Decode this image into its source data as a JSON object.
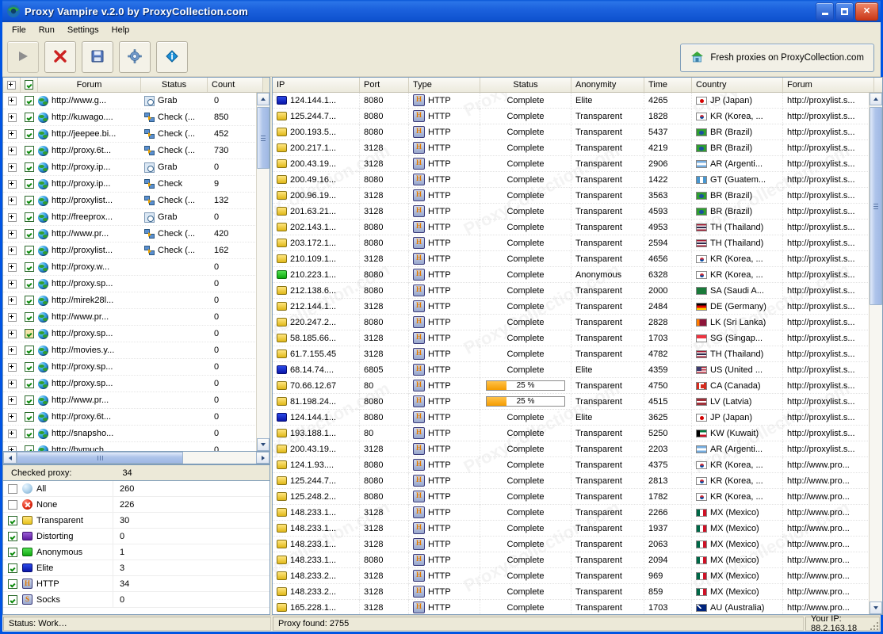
{
  "window": {
    "title": "Proxy Vampire v.2.0 by ProxyCollection.com",
    "minimize_label": "Minimize",
    "maximize_label": "Maximize",
    "close_label": "Close"
  },
  "menu": [
    "File",
    "Run",
    "Settings",
    "Help"
  ],
  "toolbar": {
    "buttons": [
      {
        "name": "start",
        "icon": "play-icon",
        "disabled": true
      },
      {
        "name": "stop",
        "icon": "red-x-icon",
        "disabled": false
      },
      {
        "name": "save",
        "icon": "floppy-disk-icon",
        "disabled": false
      },
      {
        "name": "settings",
        "icon": "gear-icon",
        "disabled": false
      },
      {
        "name": "about",
        "icon": "info-diamond-icon",
        "disabled": false
      }
    ],
    "fresh_label": "Fresh proxies on ProxyCollection.com",
    "fresh_icon": "house-icon"
  },
  "left_panel": {
    "columns": [
      "Forum",
      "Status",
      "Count"
    ],
    "header_expand_icon": "expand-all-icon",
    "header_check_icon": "check-all-icon",
    "rows": [
      {
        "name": "http://www.g...",
        "status": "Grab",
        "status_icon": "grab-icon",
        "count": "0",
        "checked": true
      },
      {
        "name": "http://kuwago....",
        "status": "Check (...",
        "status_icon": "check-icon",
        "count": "850",
        "checked": true
      },
      {
        "name": "http://jeepee.bi...",
        "status": "Check (...",
        "status_icon": "check-icon",
        "count": "452",
        "checked": true
      },
      {
        "name": "http://proxy.6t...",
        "status": "Check (...",
        "status_icon": "check-icon",
        "count": "730",
        "checked": true
      },
      {
        "name": "http://proxy.ip...",
        "status": "Grab",
        "status_icon": "grab-icon",
        "count": "0",
        "checked": true
      },
      {
        "name": "http://proxy.ip...",
        "status": "Check",
        "status_icon": "check-icon",
        "count": "9",
        "checked": true
      },
      {
        "name": "http://proxylist...",
        "status": "Check (...",
        "status_icon": "check-icon",
        "count": "132",
        "checked": true
      },
      {
        "name": "http://freeprox...",
        "status": "Grab",
        "status_icon": "grab-icon",
        "count": "0",
        "checked": true
      },
      {
        "name": "http://www.pr...",
        "status": "Check (...",
        "status_icon": "check-icon",
        "count": "420",
        "checked": true
      },
      {
        "name": "http://proxylist...",
        "status": "Check (...",
        "status_icon": "check-icon",
        "count": "162",
        "checked": true
      },
      {
        "name": "http://proxy.w...",
        "status": "",
        "status_icon": "",
        "count": "0",
        "checked": true
      },
      {
        "name": "http://proxy.sp...",
        "status": "",
        "status_icon": "",
        "count": "0",
        "checked": true
      },
      {
        "name": "http://mirek28l...",
        "status": "",
        "status_icon": "",
        "count": "0",
        "checked": true
      },
      {
        "name": "http://www.pr...",
        "status": "",
        "status_icon": "",
        "count": "0",
        "checked": true
      },
      {
        "name": "http://proxy.sp...",
        "status": "",
        "status_icon": "",
        "count": "0",
        "checked": true,
        "highlight": true
      },
      {
        "name": "http://movies.y...",
        "status": "",
        "status_icon": "",
        "count": "0",
        "checked": true
      },
      {
        "name": "http://proxy.sp...",
        "status": "",
        "status_icon": "",
        "count": "0",
        "checked": true
      },
      {
        "name": "http://proxy.sp...",
        "status": "",
        "status_icon": "",
        "count": "0",
        "checked": true
      },
      {
        "name": "http://www.pr...",
        "status": "",
        "status_icon": "",
        "count": "0",
        "checked": true
      },
      {
        "name": "http://proxy.6t...",
        "status": "",
        "status_icon": "",
        "count": "0",
        "checked": true
      },
      {
        "name": "http://snapsho...",
        "status": "",
        "status_icon": "",
        "count": "0",
        "checked": true
      },
      {
        "name": "http://bymuch...",
        "status": "",
        "status_icon": "",
        "count": "0",
        "checked": true
      }
    ]
  },
  "checked_proxy": {
    "label": "Checked proxy:",
    "value": "34",
    "rows": [
      {
        "label": "All",
        "count": "260",
        "checked": false,
        "swatch": "all"
      },
      {
        "label": "None",
        "count": "226",
        "checked": false,
        "swatch": "none"
      },
      {
        "label": "Transparent",
        "count": "30",
        "checked": true,
        "swatch": "transparent"
      },
      {
        "label": "Distorting",
        "count": "0",
        "checked": true,
        "swatch": "distorting"
      },
      {
        "label": "Anonymous",
        "count": "1",
        "checked": true,
        "swatch": "anonymous"
      },
      {
        "label": "Elite",
        "count": "3",
        "checked": true,
        "swatch": "elite"
      },
      {
        "label": "HTTP",
        "count": "34",
        "checked": true,
        "swatch": "http",
        "glyph": "H"
      },
      {
        "label": "Socks",
        "count": "0",
        "checked": true,
        "swatch": "socks",
        "glyph": "S"
      }
    ]
  },
  "table": {
    "columns": [
      "IP",
      "Port",
      "Type",
      "Status",
      "Anonymity",
      "Time",
      "Country",
      "Forum"
    ],
    "rows": [
      {
        "ip": "124.144.1...",
        "port": "8080",
        "type": "HTTP",
        "status": "Complete",
        "anonymity": "Elite",
        "time": "4265",
        "country": "JP (Japan)",
        "cc": "JP",
        "forum": "http://proxylist.s..."
      },
      {
        "ip": "125.244.7...",
        "port": "8080",
        "type": "HTTP",
        "status": "Complete",
        "anonymity": "Transparent",
        "time": "1828",
        "country": "KR (Korea, ...",
        "cc": "KR",
        "forum": "http://proxylist.s..."
      },
      {
        "ip": "200.193.5...",
        "port": "8080",
        "type": "HTTP",
        "status": "Complete",
        "anonymity": "Transparent",
        "time": "5437",
        "country": "BR (Brazil)",
        "cc": "BR",
        "forum": "http://proxylist.s..."
      },
      {
        "ip": "200.217.1...",
        "port": "3128",
        "type": "HTTP",
        "status": "Complete",
        "anonymity": "Transparent",
        "time": "4219",
        "country": "BR (Brazil)",
        "cc": "BR",
        "forum": "http://proxylist.s..."
      },
      {
        "ip": "200.43.19...",
        "port": "3128",
        "type": "HTTP",
        "status": "Complete",
        "anonymity": "Transparent",
        "time": "2906",
        "country": "AR (Argenti...",
        "cc": "AR",
        "forum": "http://proxylist.s..."
      },
      {
        "ip": "200.49.16...",
        "port": "8080",
        "type": "HTTP",
        "status": "Complete",
        "anonymity": "Transparent",
        "time": "1422",
        "country": "GT (Guatem...",
        "cc": "GT",
        "forum": "http://proxylist.s..."
      },
      {
        "ip": "200.96.19...",
        "port": "3128",
        "type": "HTTP",
        "status": "Complete",
        "anonymity": "Transparent",
        "time": "3563",
        "country": "BR (Brazil)",
        "cc": "BR",
        "forum": "http://proxylist.s..."
      },
      {
        "ip": "201.63.21...",
        "port": "3128",
        "type": "HTTP",
        "status": "Complete",
        "anonymity": "Transparent",
        "time": "4593",
        "country": "BR (Brazil)",
        "cc": "BR",
        "forum": "http://proxylist.s..."
      },
      {
        "ip": "202.143.1...",
        "port": "8080",
        "type": "HTTP",
        "status": "Complete",
        "anonymity": "Transparent",
        "time": "4953",
        "country": "TH (Thailand)",
        "cc": "TH",
        "forum": "http://proxylist.s..."
      },
      {
        "ip": "203.172.1...",
        "port": "8080",
        "type": "HTTP",
        "status": "Complete",
        "anonymity": "Transparent",
        "time": "2594",
        "country": "TH (Thailand)",
        "cc": "TH",
        "forum": "http://proxylist.s..."
      },
      {
        "ip": "210.109.1...",
        "port": "3128",
        "type": "HTTP",
        "status": "Complete",
        "anonymity": "Transparent",
        "time": "4656",
        "country": "KR (Korea, ...",
        "cc": "KR",
        "forum": "http://proxylist.s..."
      },
      {
        "ip": "210.223.1...",
        "port": "8080",
        "type": "HTTP",
        "status": "Complete",
        "anonymity": "Anonymous",
        "time": "6328",
        "country": "KR (Korea, ...",
        "cc": "KR",
        "forum": "http://proxylist.s..."
      },
      {
        "ip": "212.138.6...",
        "port": "8080",
        "type": "HTTP",
        "status": "Complete",
        "anonymity": "Transparent",
        "time": "2000",
        "country": "SA (Saudi A...",
        "cc": "SA",
        "forum": "http://proxylist.s..."
      },
      {
        "ip": "212.144.1...",
        "port": "3128",
        "type": "HTTP",
        "status": "Complete",
        "anonymity": "Transparent",
        "time": "2484",
        "country": "DE (Germany)",
        "cc": "DE",
        "forum": "http://proxylist.s..."
      },
      {
        "ip": "220.247.2...",
        "port": "8080",
        "type": "HTTP",
        "status": "Complete",
        "anonymity": "Transparent",
        "time": "2828",
        "country": "LK (Sri Lanka)",
        "cc": "LK",
        "forum": "http://proxylist.s..."
      },
      {
        "ip": "58.185.66...",
        "port": "3128",
        "type": "HTTP",
        "status": "Complete",
        "anonymity": "Transparent",
        "time": "1703",
        "country": "SG (Singap...",
        "cc": "SG",
        "forum": "http://proxylist.s..."
      },
      {
        "ip": "61.7.155.45",
        "port": "3128",
        "type": "HTTP",
        "status": "Complete",
        "anonymity": "Transparent",
        "time": "4782",
        "country": "TH (Thailand)",
        "cc": "TH",
        "forum": "http://proxylist.s..."
      },
      {
        "ip": "68.14.74....",
        "port": "6805",
        "type": "HTTP",
        "status": "Complete",
        "anonymity": "Elite",
        "time": "4359",
        "country": "US (United ...",
        "cc": "US",
        "forum": "http://proxylist.s..."
      },
      {
        "ip": "70.66.12.67",
        "port": "80",
        "type": "HTTP",
        "status": "25 %",
        "progress": 25,
        "anonymity": "Transparent",
        "time": "4750",
        "country": "CA (Canada)",
        "cc": "CA",
        "forum": "http://proxylist.s..."
      },
      {
        "ip": "81.198.24...",
        "port": "8080",
        "type": "HTTP",
        "status": "25 %",
        "progress": 25,
        "anonymity": "Transparent",
        "time": "4515",
        "country": "LV (Latvia)",
        "cc": "LV",
        "forum": "http://proxylist.s..."
      },
      {
        "ip": "124.144.1...",
        "port": "8080",
        "type": "HTTP",
        "status": "Complete",
        "anonymity": "Elite",
        "time": "3625",
        "country": "JP (Japan)",
        "cc": "JP",
        "forum": "http://proxylist.s..."
      },
      {
        "ip": "193.188.1...",
        "port": "80",
        "type": "HTTP",
        "status": "Complete",
        "anonymity": "Transparent",
        "time": "5250",
        "country": "KW (Kuwait)",
        "cc": "KW",
        "forum": "http://proxylist.s..."
      },
      {
        "ip": "200.43.19...",
        "port": "3128",
        "type": "HTTP",
        "status": "Complete",
        "anonymity": "Transparent",
        "time": "2203",
        "country": "AR (Argenti...",
        "cc": "AR",
        "forum": "http://proxylist.s..."
      },
      {
        "ip": "124.1.93....",
        "port": "8080",
        "type": "HTTP",
        "status": "Complete",
        "anonymity": "Transparent",
        "time": "4375",
        "country": "KR (Korea, ...",
        "cc": "KR",
        "forum": "http://www.pro..."
      },
      {
        "ip": "125.244.7...",
        "port": "8080",
        "type": "HTTP",
        "status": "Complete",
        "anonymity": "Transparent",
        "time": "2813",
        "country": "KR (Korea, ...",
        "cc": "KR",
        "forum": "http://www.pro..."
      },
      {
        "ip": "125.248.2...",
        "port": "8080",
        "type": "HTTP",
        "status": "Complete",
        "anonymity": "Transparent",
        "time": "1782",
        "country": "KR (Korea, ...",
        "cc": "KR",
        "forum": "http://www.pro..."
      },
      {
        "ip": "148.233.1...",
        "port": "3128",
        "type": "HTTP",
        "status": "Complete",
        "anonymity": "Transparent",
        "time": "2266",
        "country": "MX (Mexico)",
        "cc": "MX",
        "forum": "http://www.pro..."
      },
      {
        "ip": "148.233.1...",
        "port": "3128",
        "type": "HTTP",
        "status": "Complete",
        "anonymity": "Transparent",
        "time": "1937",
        "country": "MX (Mexico)",
        "cc": "MX",
        "forum": "http://www.pro..."
      },
      {
        "ip": "148.233.1...",
        "port": "3128",
        "type": "HTTP",
        "status": "Complete",
        "anonymity": "Transparent",
        "time": "2063",
        "country": "MX (Mexico)",
        "cc": "MX",
        "forum": "http://www.pro..."
      },
      {
        "ip": "148.233.1...",
        "port": "8080",
        "type": "HTTP",
        "status": "Complete",
        "anonymity": "Transparent",
        "time": "2094",
        "country": "MX (Mexico)",
        "cc": "MX",
        "forum": "http://www.pro..."
      },
      {
        "ip": "148.233.2...",
        "port": "3128",
        "type": "HTTP",
        "status": "Complete",
        "anonymity": "Transparent",
        "time": "969",
        "country": "MX (Mexico)",
        "cc": "MX",
        "forum": "http://www.pro..."
      },
      {
        "ip": "148.233.2...",
        "port": "3128",
        "type": "HTTP",
        "status": "Complete",
        "anonymity": "Transparent",
        "time": "859",
        "country": "MX (Mexico)",
        "cc": "MX",
        "forum": "http://www.pro..."
      },
      {
        "ip": "165.228.1...",
        "port": "3128",
        "type": "HTTP",
        "status": "Complete",
        "anonymity": "Transparent",
        "time": "1703",
        "country": "AU (Australia)",
        "cc": "AU",
        "forum": "http://www.pro..."
      }
    ]
  },
  "statusbar": {
    "status": "Status: Work…",
    "found": "Proxy found: 2755",
    "ip": "Your IP: 88.2.163.18"
  },
  "watermark": "ProxyCollection.com"
}
